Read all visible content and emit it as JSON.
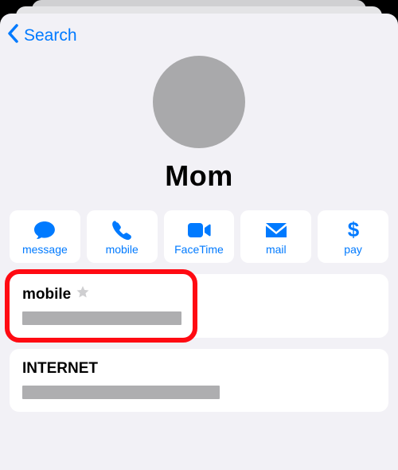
{
  "nav": {
    "back_label": "Search"
  },
  "contact": {
    "name": "Mom"
  },
  "actions": [
    {
      "label": "message"
    },
    {
      "label": "mobile"
    },
    {
      "label": "FaceTime"
    },
    {
      "label": "mail"
    },
    {
      "label": "pay"
    }
  ],
  "fields": [
    {
      "label": "mobile",
      "starred": true
    },
    {
      "label": "INTERNET",
      "starred": false
    }
  ]
}
